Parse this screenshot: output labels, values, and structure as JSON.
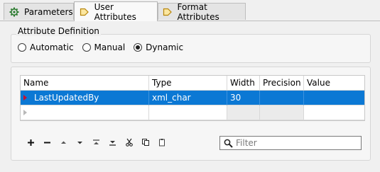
{
  "tabs": [
    {
      "label": "Parameters",
      "icon": "gear-icon"
    },
    {
      "label": "User Attributes",
      "icon": "tag-icon"
    },
    {
      "label": "Format Attributes",
      "icon": "tag-icon"
    }
  ],
  "attribute_definition": {
    "title": "Attribute Definition",
    "options": [
      "Automatic",
      "Manual",
      "Dynamic"
    ],
    "selected": "Dynamic"
  },
  "table": {
    "columns": [
      "Name",
      "Type",
      "Width",
      "Precision",
      "Value"
    ],
    "rows": [
      {
        "name": "LastUpdatedBy",
        "type": "xml_char",
        "width": "30",
        "precision": "",
        "value": ""
      }
    ]
  },
  "toolbar": {
    "buttons": [
      "add-icon",
      "remove-icon",
      "move-up-icon",
      "move-down-icon",
      "move-top-icon",
      "move-bottom-icon",
      "cut-icon",
      "copy-icon",
      "paste-icon"
    ]
  },
  "filter": {
    "placeholder": "Filter"
  },
  "colors": {
    "selection": "#0b78d4",
    "tab_icon": "#d4a017",
    "indicator": "#b22222"
  }
}
